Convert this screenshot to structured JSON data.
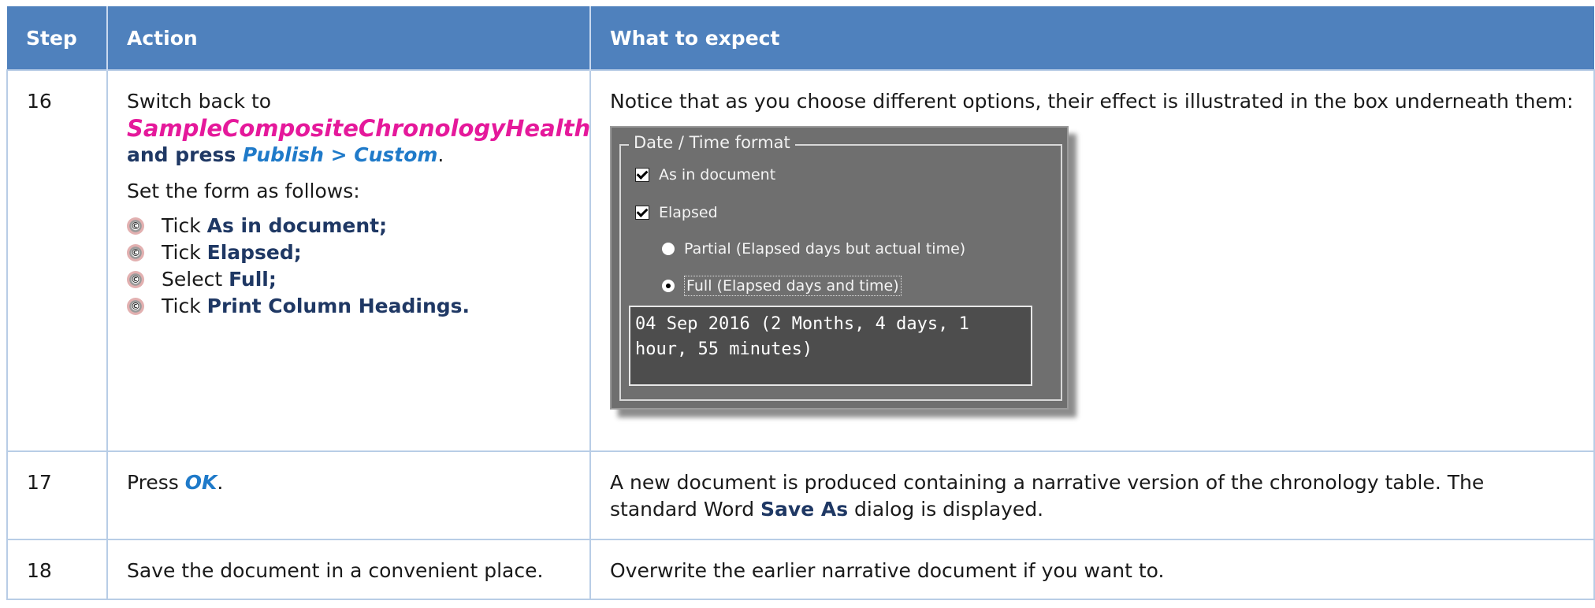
{
  "headers": {
    "step": "Step",
    "action": "Action",
    "expect": "What to expect"
  },
  "rows": [
    {
      "step": "16",
      "action": {
        "line1": "Switch back to",
        "doc_name": "SampleCompositeChronologyHealth",
        "line2_prefix": "and press ",
        "menu_path": "Publish > Custom",
        "line2_suffix": ".",
        "instruction": "Set the form as follows:",
        "ticks": [
          {
            "prefix": "Tick ",
            "bold": "As in document;"
          },
          {
            "prefix": "Tick ",
            "bold": "Elapsed;"
          },
          {
            "prefix": "Select ",
            "bold": "Full;"
          },
          {
            "prefix": "Tick ",
            "bold": "Print Column Headings."
          }
        ]
      },
      "expect": {
        "text": "Notice that as you choose different options, their effect is illustrated in the box underneath them:",
        "dialog": {
          "group_title": "Date / Time format",
          "as_in_document": "As in document",
          "elapsed": "Elapsed",
          "partial": "Partial (Elapsed days but actual time)",
          "full": "Full (Elapsed days and time)",
          "preview": "04 Sep 2016 (2 Months, 4 days, 1\nhour, 55 minutes)"
        }
      }
    },
    {
      "step": "17",
      "action": {
        "prefix": "Press ",
        "button": "OK",
        "suffix": "."
      },
      "expect": {
        "prefix": "A new document is produced containing a narrative version of the chronology table. The standard Word ",
        "bold": "Save As",
        "suffix": " dialog is displayed."
      }
    },
    {
      "step": "18",
      "action": {
        "text": "Save the document in a convenient place."
      },
      "expect": {
        "text": "Overwrite the earlier narrative document if you want to."
      }
    }
  ],
  "colors": {
    "header_bg": "#4f81bd",
    "doc_name": "#e5199b",
    "menu_link": "#1f7ac9",
    "bold_text": "#1f3864"
  }
}
